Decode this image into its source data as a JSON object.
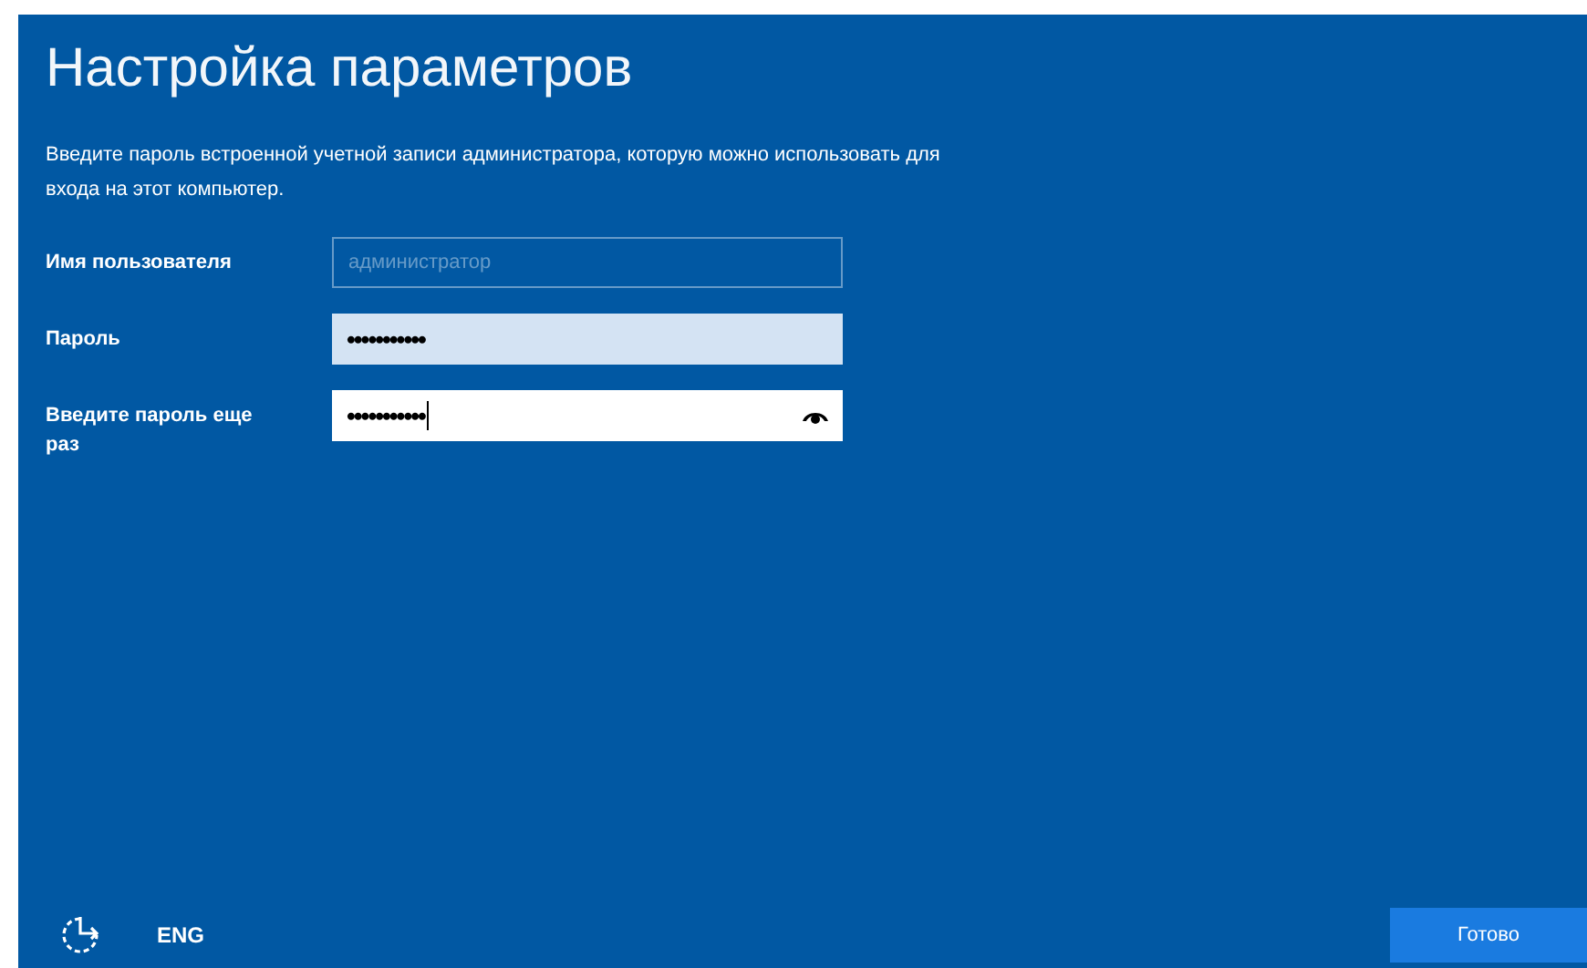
{
  "title": "Настройка параметров",
  "description": "Введите пароль встроенной учетной записи администратора, которую можно использовать для входа на этот компьютер.",
  "fields": [
    {
      "label": "Имя пользователя",
      "value": "администратор",
      "disabled": true,
      "focused": false,
      "reveal_button": false
    },
    {
      "label": "Пароль",
      "value": "•••••••••••",
      "disabled": false,
      "focused": false,
      "reveal_button": false
    },
    {
      "label": "Введите пароль еще раз",
      "value": "•••••••••••",
      "disabled": false,
      "focused": true,
      "reveal_button": true
    }
  ],
  "footer": {
    "language": "ENG",
    "button": "Готово"
  }
}
